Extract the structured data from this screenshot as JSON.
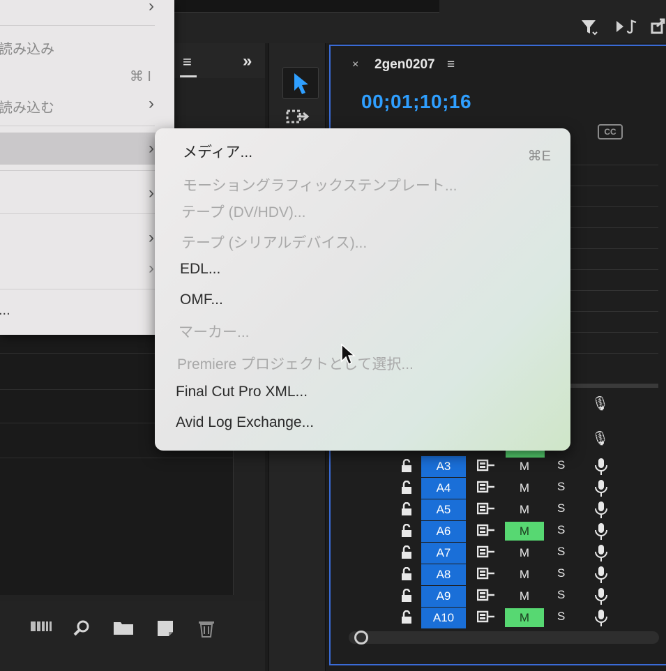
{
  "left_menu": {
    "items": [
      {
        "label": "読み込み",
        "visible_text": "読み込み",
        "dimmed": true,
        "shortcut": "⌘ I"
      },
      {
        "label": "読み込む",
        "visible_text": "読み込む"
      },
      {
        "label": "...",
        "visible_text": "..."
      }
    ],
    "chevron": "›"
  },
  "submenu": {
    "items": [
      {
        "label": "メディア...",
        "enabled": true,
        "shortcut": "⌘E"
      },
      {
        "label": "モーショングラフィックステンプレート...",
        "enabled": false
      },
      {
        "label": "テープ (DV/HDV)...",
        "enabled": false
      },
      {
        "label": "テープ (シリアルデバイス)...",
        "enabled": false
      },
      {
        "label": "EDL...",
        "enabled": true
      },
      {
        "label": "OMF...",
        "enabled": true
      },
      {
        "label": "マーカー...",
        "enabled": false
      },
      {
        "label": "Premiere プロジェクトとして選択...",
        "enabled": false
      },
      {
        "label": "Final Cut Pro XML...",
        "enabled": true
      },
      {
        "label": "Avid Log Exchange...",
        "enabled": true
      }
    ]
  },
  "timeline": {
    "close": "×",
    "sequence_name": "2gen0207",
    "menu": "≡",
    "timecode": "00;01;10;16",
    "cc_label": "CC",
    "tracks": [
      {
        "name": "A3",
        "mute": "M",
        "mute_on": false,
        "solo": "S"
      },
      {
        "name": "A4",
        "mute": "M",
        "mute_on": false,
        "solo": "S"
      },
      {
        "name": "A5",
        "mute": "M",
        "mute_on": false,
        "solo": "S"
      },
      {
        "name": "A6",
        "mute": "M",
        "mute_on": true,
        "solo": "S"
      },
      {
        "name": "A7",
        "mute": "M",
        "mute_on": false,
        "solo": "S"
      },
      {
        "name": "A8",
        "mute": "M",
        "mute_on": false,
        "solo": "S"
      },
      {
        "name": "A9",
        "mute": "M",
        "mute_on": false,
        "solo": "S"
      },
      {
        "name": "A10",
        "mute": "M",
        "mute_on": true,
        "solo": "S"
      }
    ]
  },
  "project_panel": {
    "menu": "≡",
    "expand": "»"
  },
  "icons": {
    "filter": "filter-icon",
    "audio": "audio-icon",
    "export": "export-icon",
    "lock": "lock-icon",
    "sync": "sync-icon",
    "mic": "microphone-icon",
    "search": "search-icon",
    "folder": "folder-icon",
    "new_item": "new-item-icon",
    "trash": "trash-icon",
    "list_view": "list-view-icon"
  },
  "colors": {
    "timecode": "#2f9fff",
    "track_label": "#1a6fd8",
    "mute_active": "#57d872",
    "timeline_border": "#3a6bd6"
  }
}
